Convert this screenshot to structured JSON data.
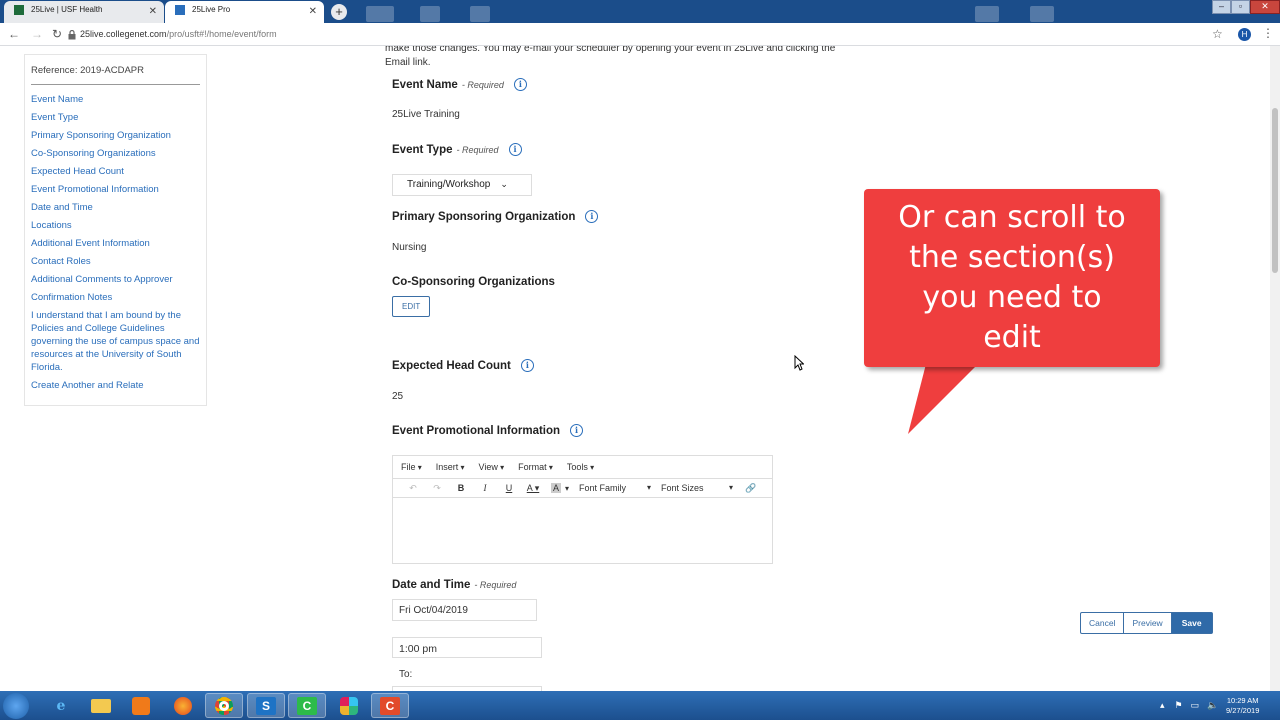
{
  "browser": {
    "tabs": [
      {
        "title": "25Live | USF Health",
        "close": "✕"
      },
      {
        "title": "25Live Pro",
        "close": "✕"
      }
    ],
    "new_tab": "+",
    "url_host": "25live.collegenet.com",
    "url_path": "/pro/usft#!/home/event/form",
    "profile_initial": "H"
  },
  "sidebar": {
    "reference": "Reference: 2019-ACDAPR",
    "items": [
      "Event Name",
      "Event Type",
      "Primary Sponsoring Organization",
      "Co-Sponsoring Organizations",
      "Expected Head Count",
      "Event Promotional Information",
      "Date and Time",
      "Locations",
      "Additional Event Information",
      "Contact Roles",
      "Additional Comments to Approver",
      "Confirmation Notes",
      "I understand that I am bound by the Policies and College Guidelines governing the use of campus space and resources at the University of South Florida.",
      "Create Another and Relate"
    ]
  },
  "form": {
    "intro_line1": "make those changes. You may e-mail your scheduler by opening your event in 25Live and clicking the",
    "intro_line2": "Email link.",
    "required_text": "- Required",
    "info_glyph": "i",
    "event_name": {
      "label": "Event Name",
      "value": "25Live Training"
    },
    "event_type": {
      "label": "Event Type",
      "value": "Training/Workshop"
    },
    "primary_org": {
      "label": "Primary Sponsoring Organization",
      "value": "Nursing"
    },
    "co_sponsoring": {
      "label": "Co-Sponsoring Organizations",
      "button": "EDIT"
    },
    "head_count": {
      "label": "Expected Head Count",
      "value": "25"
    },
    "promo": {
      "label": "Event Promotional Information",
      "menu": [
        "File",
        "Insert",
        "View",
        "Format",
        "Tools"
      ],
      "font_family": "Font Family",
      "font_sizes": "Font Sizes"
    },
    "date_time": {
      "label": "Date and Time",
      "date": "Fri Oct/04/2019",
      "start_time": "1:00 pm",
      "to_label": "To:"
    }
  },
  "actions": {
    "cancel": "Cancel",
    "preview": "Preview",
    "save": "Save"
  },
  "callout": {
    "line1": "Or can scroll to",
    "line2": "the section(s)",
    "line3": "you need to",
    "line4": "edit",
    "color": "#ef3e3e"
  },
  "taskbar": {
    "time": "10:29 AM",
    "date": "9/27/2019"
  }
}
